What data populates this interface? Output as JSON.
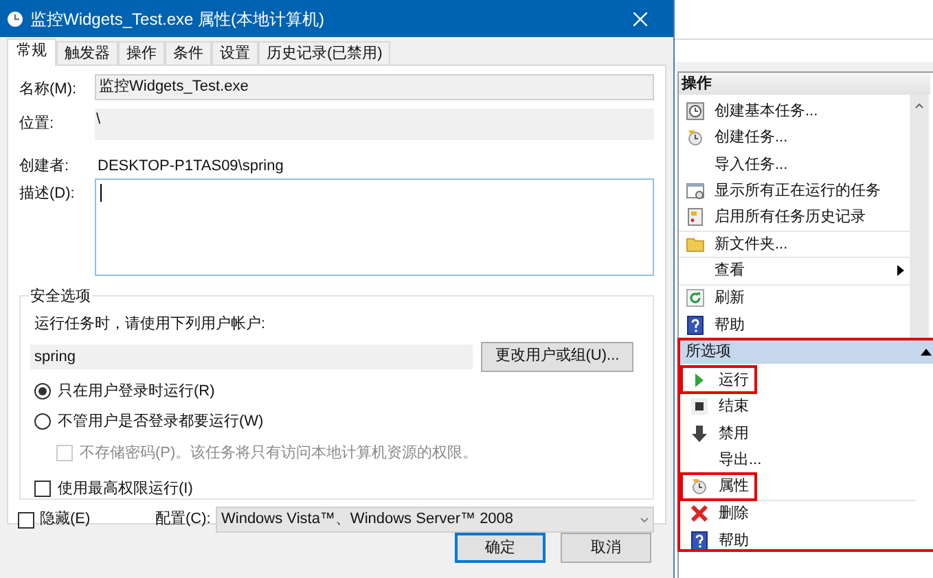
{
  "window": {
    "title": "监控Widgets_Test.exe 属性(本地计算机)"
  },
  "tabs": [
    {
      "label": "常规",
      "selected": true
    },
    {
      "label": "触发器",
      "selected": false
    },
    {
      "label": "操作",
      "selected": false
    },
    {
      "label": "条件",
      "selected": false
    },
    {
      "label": "设置",
      "selected": false
    },
    {
      "label": "历史记录(已禁用)",
      "selected": false
    }
  ],
  "general": {
    "name_label": "名称(M):",
    "name_value": "监控Widgets_Test.exe",
    "location_label": "位置:",
    "location_value": "\\",
    "author_label": "创建者:",
    "author_value": "DESKTOP-P1TAS09\\spring",
    "description_label": "描述(D):"
  },
  "security": {
    "title": "安全选项",
    "account_prompt": "运行任务时，请使用下列用户帐户:",
    "account_value": "spring",
    "change_button": "更改用户或组(U)...",
    "options": [
      {
        "kind": "radio",
        "label": "只在用户登录时运行(R)",
        "selected": true,
        "disabled": false
      },
      {
        "kind": "radio",
        "label": "不管用户是否登录都要运行(W)",
        "selected": false,
        "disabled": false
      },
      {
        "kind": "checkbox",
        "label": "不存储密码(P)。该任务将只有访问本地计算机资源的权限。",
        "checked": false,
        "disabled": true
      },
      {
        "kind": "checkbox",
        "label": "使用最高权限运行(I)",
        "checked": false,
        "disabled": false
      }
    ]
  },
  "hidden": {
    "label": "隐藏(E)",
    "checked": false
  },
  "configure": {
    "label": "配置(C):",
    "value": "Windows Vista™、Windows Server™ 2008"
  },
  "buttons": [
    "确定",
    "取消"
  ],
  "actions_panel": {
    "title": "操作",
    "items": [
      {
        "label": "创建基本任务...",
        "kind": "clock",
        "submenu": false,
        "divider": false
      },
      {
        "label": "创建任务...",
        "kind": "task",
        "submenu": false,
        "divider": false
      },
      {
        "label": "导入任务...",
        "kind": "plain",
        "submenu": false,
        "divider": false
      },
      {
        "label": "显示所有正在运行的任务",
        "kind": "window",
        "submenu": false,
        "divider": false
      },
      {
        "label": "启用所有任务历史记录",
        "kind": "log",
        "submenu": false,
        "divider": true
      },
      {
        "label": "新文件夹...",
        "kind": "folder",
        "submenu": false,
        "divider": true
      },
      {
        "label": "查看",
        "kind": "plain",
        "submenu": true,
        "divider": true
      },
      {
        "label": "刷新",
        "kind": "refresh",
        "submenu": false,
        "divider": false
      },
      {
        "label": "帮助",
        "kind": "help",
        "submenu": false,
        "divider": false
      }
    ]
  },
  "selected_panel": {
    "title": "所选项",
    "expanded": true,
    "highlighted": true,
    "items": [
      {
        "label": "运行",
        "kind": "play",
        "highlighted": true,
        "divider": false
      },
      {
        "label": "结束",
        "kind": "stop",
        "highlighted": false,
        "divider": false
      },
      {
        "label": "禁用",
        "kind": "down",
        "highlighted": false,
        "divider": false
      },
      {
        "label": "导出...",
        "kind": "plain",
        "highlighted": false,
        "divider": false
      },
      {
        "label": "属性",
        "kind": "task",
        "highlighted": true,
        "divider": true
      },
      {
        "label": "删除",
        "kind": "delete",
        "highlighted": false,
        "divider": false
      },
      {
        "label": "帮助",
        "kind": "help",
        "highlighted": false,
        "divider": false
      }
    ]
  }
}
